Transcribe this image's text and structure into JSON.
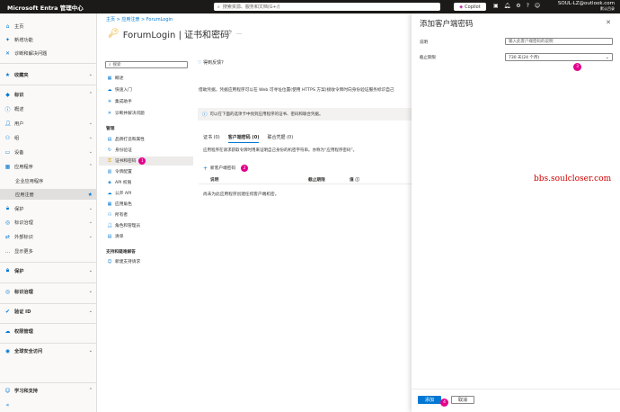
{
  "topbar": {
    "brand": "Microsoft Entra 管理中心",
    "search_placeholder": "搜索资源、服务和文档(G+/)",
    "copilot_label": "Copilot",
    "account_email": "SOUL-LZ@outlook.com",
    "account_dir": "默认目录"
  },
  "left_nav": {
    "home": "主页",
    "whats_new": "新增功能",
    "diagnose": "诊断和解决问题",
    "favorites": "收藏夹",
    "identity": "标识",
    "overview": "概述",
    "users": "用户",
    "groups": "组",
    "devices": "设备",
    "applications": "应用程序",
    "enterprise_apps": "企业应用程序",
    "app_registrations": "应用注册",
    "protection": "保护",
    "identity_governance": "标识治理",
    "external_identities": "外部标识",
    "show_more": "显示更多",
    "protection2": "保护",
    "identity_governance2": "标识治理",
    "verified_id": "验证 ID",
    "permissions_mgmt": "权限管理",
    "global_secure_access": "全球安全访问",
    "learn_support": "学习和支持"
  },
  "breadcrumb": "主页 > 应用注册 > ForumLogin",
  "page": {
    "title": "ForumLogin | 证书和密码"
  },
  "blade_nav": {
    "search_placeholder": "搜索",
    "items": [
      "概述",
      "快速入门",
      "集成助手",
      "诊断并解决问题"
    ],
    "manage_header": "管理",
    "manage": [
      "品牌打造和属性",
      "身份验证",
      "证书和密码",
      "令牌配置",
      "API 权限",
      "公开 API",
      "应用角色",
      "所有者",
      "角色和管理员",
      "清单"
    ],
    "support_header": "支持和疑难解答",
    "support": [
      "新建支持请求"
    ],
    "active_badge": "1"
  },
  "content": {
    "feedback": "得到反馈?",
    "description": "借助凭据，凭据应用程序可以在 Web 可寻址位置(使用 HTTPS 方案)接收令牌时向身份验证服务标识自己",
    "info": "可以在下面的选项卡中找到应用程序的证书、密码和联合凭据。",
    "tabs": [
      "证书 (0)",
      "客户端密码 (0)",
      "联合凭据 (0)"
    ],
    "tab_desc": "应用程序在请求获取令牌时用来证明自己身份的机密字符串。亦称为“应用程序密码”。",
    "new_secret": "新客户端密码",
    "new_badge": "2",
    "columns": [
      "说明",
      "截止期限",
      "值"
    ],
    "empty": "尚未为此应用程序创建任何客户端机密。"
  },
  "overlay": {
    "title": "添加客户端密码",
    "description_label": "说明",
    "description_placeholder": "输入此客户端密码的说明",
    "expires_label": "截止期限",
    "expires_value": "730 天(24 个月)",
    "expires_badge": "3",
    "add_label": "添加",
    "add_badge": "4",
    "cancel_label": "取消"
  },
  "watermark": "bbs.soulcloser.com",
  "colors": {
    "accent": "#0078d4",
    "badge": "#e3008c",
    "topbar": "#1b1a19",
    "watermark": "#d00000"
  }
}
